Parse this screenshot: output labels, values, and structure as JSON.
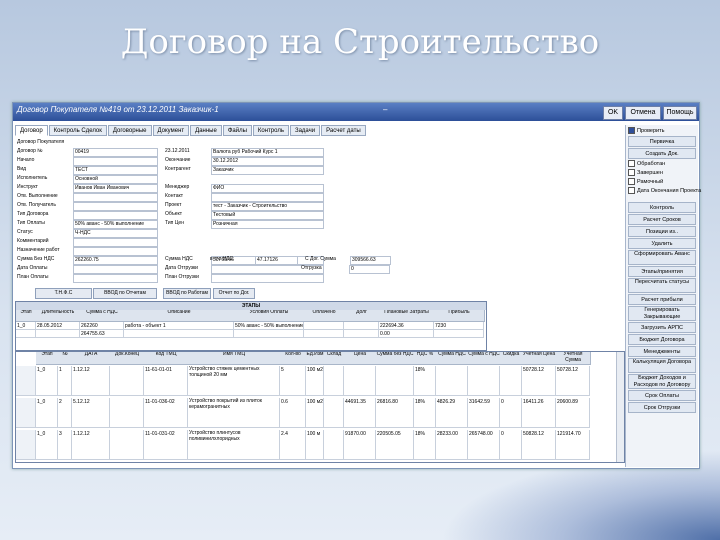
{
  "slide": {
    "title": "Договор на Строительство"
  },
  "window": {
    "title": "Договор Покупателя №419 от 23.12.2011 Заказчик-1",
    "dash": "–",
    "ok": "OK",
    "cancel": "Отмена",
    "help": "Помощь"
  },
  "tabs": [
    "Договор",
    "Контроль Сделок",
    "Договорные",
    "Документ",
    "Данные",
    "Файлы",
    "Контроль",
    "Задачи",
    "Расчет даты"
  ],
  "form": {
    "rows": [
      {
        "label": "Договор Покупателя",
        "v1": "",
        "l2": "",
        "v2": ""
      },
      {
        "label": "Договор №",
        "v1": "00419",
        "l2": "23.12.2011",
        "v2": "Валюта  руб  Рабочий Курс  1"
      },
      {
        "label": "Начало",
        "v1": "",
        "l2": "Окончание",
        "v2": "30.12.2012"
      },
      {
        "label": "Вид",
        "v1": "ТЕСТ",
        "l2": "Контрагент",
        "v2": "Заказчик"
      },
      {
        "label": "Исполнитель",
        "v1": "Основной",
        "l2": "",
        "v2": ""
      },
      {
        "label": "Инструкт",
        "v1": "Иванов Иван Иванович",
        "l2": "Менеджер",
        "v2": "ФИО"
      },
      {
        "label": "Отв. Выполнение",
        "v1": "",
        "l2": "Контакт",
        "v2": ""
      },
      {
        "label": "Отв. Получатель",
        "v1": "",
        "l2": "Проект",
        "v2": "тест - Заказчик - Строительство"
      },
      {
        "label": "Тип Договора",
        "v1": "",
        "l2": "Объект",
        "v2": "Тестовый"
      },
      {
        "label": "Тип Оплаты",
        "v1": "50% аванс - 50% выполнение",
        "l2": "Тип Цен",
        "v2": "Розничная"
      },
      {
        "label": "Статус",
        "v1": "Ч-НДС",
        "l2": "",
        "v2": ""
      },
      {
        "label": "Комментарий",
        "v1": "",
        "l2": "",
        "v2": ""
      },
      {
        "label": "Назначение работ",
        "v1": "",
        "l2": "",
        "v2": ""
      },
      {
        "label": "Сумма Без НДС",
        "v1": "262260.75",
        "l2": "Сумма НДС",
        "v2": "50760.46"
      },
      {
        "label": "Дата Оплаты",
        "v1": "",
        "l2": "Дата Отгрузки",
        "v2": ""
      },
      {
        "label": "План Оплаты",
        "v1": "",
        "l2": "План Отгрузки",
        "v2": ""
      }
    ],
    "extra": {
      "nds_label": "в т.ч. НДС",
      "nds_val": "47.17126",
      "total_label": "С Дог. Сумма",
      "total_val": "309566.63",
      "pay_label": "Отгрузка",
      "pay_val": "0"
    }
  },
  "buttons": [
    "Т.Н.Ф.С",
    "ВВОД по Отчетам",
    "ВВОД по Работам",
    "Отчет по Дог."
  ],
  "sidebar": {
    "items": [
      {
        "type": "check",
        "label": "Проверить",
        "on": true
      },
      {
        "type": "btn",
        "label": "Первичка"
      },
      {
        "type": "btn",
        "label": "Создать Док."
      },
      {
        "type": "check",
        "label": "Обработан",
        "on": false
      },
      {
        "type": "check",
        "label": "Завершен",
        "on": false
      },
      {
        "type": "check",
        "label": "Рамочный",
        "on": false
      },
      {
        "type": "check",
        "label": "Дата Окончания Проекта",
        "on": false
      },
      {
        "type": "btn",
        "label": "Контроль"
      },
      {
        "type": "btn",
        "label": "Расчет Сроков"
      },
      {
        "type": "btn",
        "label": "Позиции из.."
      },
      {
        "type": "btn",
        "label": "Удалить"
      },
      {
        "type": "btn",
        "label": "Сформировать Аванс"
      },
      {
        "type": "btn",
        "label": "Этапы/принятия"
      },
      {
        "type": "btn",
        "label": "Пересчитать статусы"
      },
      {
        "type": "btn",
        "label": "Расчет прибыли"
      },
      {
        "type": "btn",
        "label": "Генерировать Закрывающие"
      },
      {
        "type": "btn",
        "label": "Загрузить АРПС"
      },
      {
        "type": "btn",
        "label": "Бюджет Договора"
      },
      {
        "type": "btn",
        "label": "Менеджменты"
      },
      {
        "type": "btn",
        "label": "Калькуляция Договора"
      },
      {
        "type": "btn",
        "label": "Бюджет Доходов и Расходов по Договору"
      },
      {
        "type": "btn",
        "label": "Срок Оплаты"
      },
      {
        "type": "btn",
        "label": "Срок Отгрузки"
      }
    ]
  },
  "grid1": {
    "caption": "ЭТАПЫ",
    "headers": [
      "Этап",
      "Длительность",
      "Сумма с НДС",
      "Описание",
      "Условия Оплаты",
      "Оплачено",
      "Долг",
      "Плановые Затраты",
      "Прибыль"
    ],
    "rows": [
      [
        "1_0",
        "28.05.2012",
        "262260",
        "работа - объект 1",
        "50% аванс - 50% выполнение",
        "",
        "",
        "222694.36",
        "7230"
      ],
      [
        "",
        "",
        "264755.63",
        "",
        "",
        "",
        "",
        "0.00",
        ""
      ]
    ]
  },
  "grid2": {
    "headers": [
      "Этап",
      "№",
      "ДАТА",
      "Док.Конец",
      "Код ТМЦ",
      "Имя ТМЦ",
      "Кол-во",
      "Ед.Изм",
      "Склад",
      "Цена",
      "Сумма без НДС",
      "НДС %",
      "Сумма НДС",
      "Сумма с НДС",
      "Скидка",
      "Учетная Цена",
      "Учетная Сумма"
    ],
    "rows": [
      [
        "1_0",
        "1",
        "1.12.12",
        "",
        "11-61-01-01",
        "Устройство стяжек цементных толщиной 20 мм",
        "5",
        "100 м2",
        "",
        "",
        "",
        "18%",
        "",
        "",
        "",
        "50728.12",
        "50728.12"
      ],
      [
        "1_0",
        "2",
        "5.12.12",
        "",
        "11-01-036-02",
        "Устройство покрытий из плиток керамогранитных",
        "0.6",
        "100 м2",
        "",
        "44691.35",
        "26816.80",
        "18%",
        "4826.29",
        "31642.59",
        "0",
        "16411.26",
        "20600.89"
      ],
      [
        "1_0",
        "3",
        "1.12.12",
        "",
        "11-01-031-02",
        "Устройство плинтусов поливинилхлоридных",
        "2.4",
        "100 м",
        "",
        "91870.00",
        "220505.05",
        "18%",
        "28233.00",
        "265748.00",
        "0",
        "50828.12",
        "121914.70"
      ]
    ]
  }
}
